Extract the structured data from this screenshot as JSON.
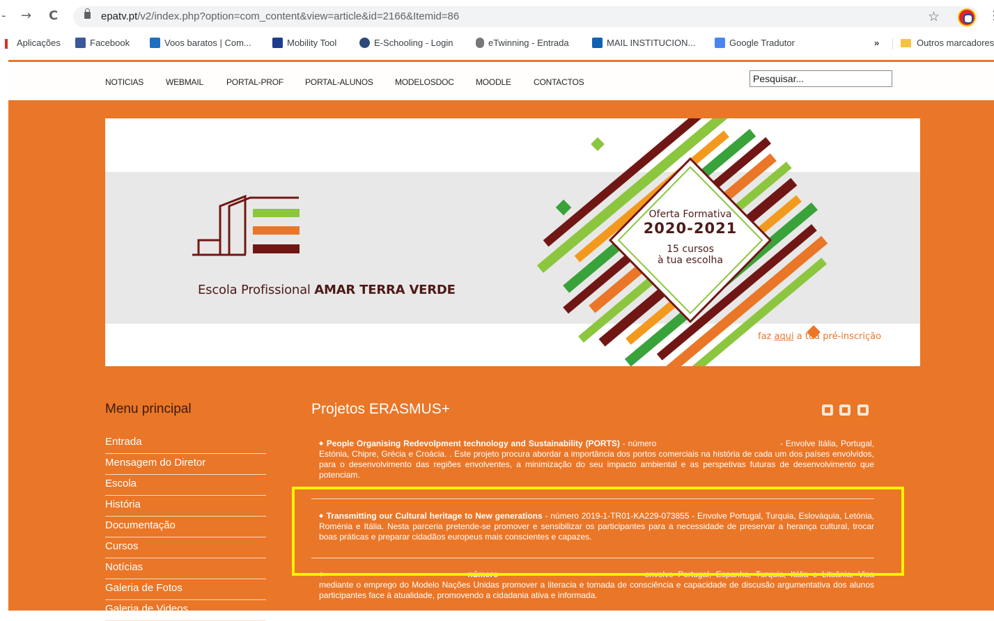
{
  "browser": {
    "url_host": "epatv.pt",
    "url_path": "/v2/index.php?option=com_content&view=article&id=2166&Itemid=86",
    "back_glyph": "-",
    "forward_glyph": "→",
    "reload_glyph": "C",
    "star_glyph": "☆",
    "menu_glyph": "⋮"
  },
  "bookmarks": {
    "items": [
      "Aplicações",
      "Facebook",
      "Voos baratos | Com...",
      "Mobility Tool",
      "E-Schooling - Login",
      "eTwinning - Entrada",
      "MAIL INSTITUCION...",
      "Google Tradutor"
    ],
    "overflow": "»",
    "other": "Outros marcadores"
  },
  "site_nav": {
    "items": [
      "NOTICIAS",
      "WEBMAIL",
      "PORTAL-PROF",
      "PORTAL-ALUNOS",
      "MODELOSDOC",
      "MOODLE",
      "CONTACTOS"
    ],
    "search_placeholder": "Pesquisar..."
  },
  "banner": {
    "school_prefix": "Escola Profissional",
    "school_name": "AMAR TERRA VERDE",
    "offer_line1": "Oferta Formativa",
    "offer_line2": "2020-2021",
    "offer_line3": "15 cursos",
    "offer_line4": "à tua escolha",
    "preinsc_pre": "faz",
    "preinsc_link": "aqui",
    "preinsc_post": "a tua pré-inscrição"
  },
  "sidebar": {
    "title": "Menu principal",
    "items": [
      "Entrada",
      "Mensagem do Diretor",
      "Escola",
      "História",
      "Documentação",
      "Cursos",
      "Notícias",
      "Galeria de Fotos",
      "Galeria de Videos"
    ]
  },
  "article": {
    "title": "Projetos ERASMUS+",
    "p1_bold": "People Organising Redevolpment technology and Sustainability (PORTS)",
    "p1_a": " - número ",
    "p1_b": " - Envolve Itália, Portugal, Estónia, Chipre, Grécia e Croácia. . Este projeto procura abordar a importância dos portos comerciais na história de cada um dos países envolvidos, para o desenvolvimento das regiões envolventes, a minimização do seu impacto ambiental e as perspetivas futuras de desenvolvimento que potenciam.",
    "p2_bold": "Transmitting our Cultural heritage to New generations",
    "p2_rest": " -  número 2019-1-TR01-KA229-073855 - Envolve Portugal, Turquia, Eslováquia, Letónia, Roménia e Itália. Nesta parceria pretende-se promover e sensibilizar os participantes para a necessidade de preservar a herança cultural, trocar boas práticas e preparar cidadãos europeus mais conscientes e capazes.",
    "p3_a": "número",
    "p3_b": "envolve Portugal, Espanha, Turquia, Itália e Lituânia. Visa mediante o emprego do Modelo Nações Unidas promover a literacia e tomada de consciência e capacidade de discusão argumentativa dos alunos participantes face à atualidade, promovendo a cidadania ativa e informada.",
    "icons": [
      "pdf-icon",
      "print-icon",
      "email-icon"
    ]
  },
  "colors": {
    "brand_orange": "#ea7627",
    "dark_red": "#701715",
    "green": "#8cc63f",
    "highlight": "#fbf301"
  }
}
